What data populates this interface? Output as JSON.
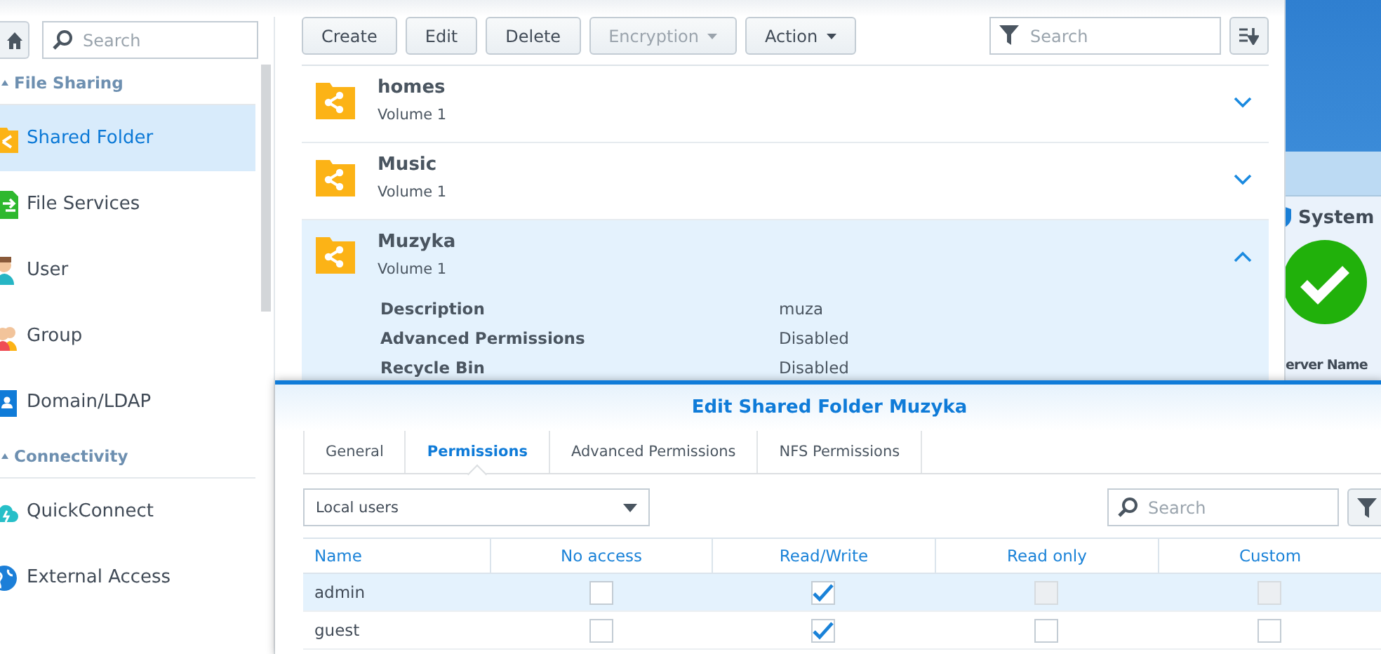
{
  "sidebar": {
    "search": {
      "placeholder": "Search"
    },
    "sections": [
      {
        "title": "File Sharing",
        "expanded": true,
        "items": [
          {
            "label": "Shared Folder",
            "kind": "shared-folder",
            "selected": true
          },
          {
            "label": "File Services",
            "kind": "file-services",
            "selected": false
          },
          {
            "label": "User",
            "kind": "user",
            "selected": false
          },
          {
            "label": "Group",
            "kind": "group",
            "selected": false
          },
          {
            "label": "Domain/LDAP",
            "kind": "domain",
            "selected": false
          }
        ]
      },
      {
        "title": "Connectivity",
        "expanded": true,
        "items": [
          {
            "label": "QuickConnect",
            "kind": "cloud",
            "selected": false
          },
          {
            "label": "External Access",
            "kind": "globe",
            "selected": false
          }
        ]
      }
    ]
  },
  "toolbar": {
    "buttons": [
      {
        "label": "Create",
        "disabled": false,
        "menu": false
      },
      {
        "label": "Edit",
        "disabled": false,
        "menu": false
      },
      {
        "label": "Delete",
        "disabled": false,
        "menu": false
      },
      {
        "label": "Encryption",
        "disabled": true,
        "menu": true
      },
      {
        "label": "Action",
        "disabled": false,
        "menu": true
      }
    ],
    "search": {
      "placeholder": "Search"
    }
  },
  "folders": [
    {
      "name": "homes",
      "volume": "Volume 1",
      "expanded": false,
      "selected": false
    },
    {
      "name": "Music",
      "volume": "Volume 1",
      "expanded": false,
      "selected": false
    },
    {
      "name": "Muzyka",
      "volume": "Volume 1",
      "expanded": true,
      "selected": true,
      "details": [
        {
          "label": "Description",
          "value": "muza"
        },
        {
          "label": "Advanced Permissions",
          "value": "Disabled"
        },
        {
          "label": "Recycle Bin",
          "value": "Disabled"
        }
      ]
    }
  ],
  "desktop_widget": {
    "title": "System",
    "server_label": "erver Name"
  },
  "dialog": {
    "title": "Edit Shared Folder Muzyka",
    "tabs": [
      {
        "label": "General",
        "selected": false
      },
      {
        "label": "Permissions",
        "selected": true
      },
      {
        "label": "Advanced Permissions",
        "selected": false
      },
      {
        "label": "NFS Permissions",
        "selected": false
      }
    ],
    "user_filter": {
      "value": "Local users"
    },
    "search": {
      "placeholder": "Search"
    },
    "columns": [
      "Name",
      "No access",
      "Read/Write",
      "Read only",
      "Custom"
    ],
    "rows": [
      {
        "name": "admin",
        "selected": true,
        "permissions": [
          {
            "checked": false,
            "disabled": false
          },
          {
            "checked": true,
            "disabled": false
          },
          {
            "checked": false,
            "disabled": true
          },
          {
            "checked": false,
            "disabled": true
          }
        ]
      },
      {
        "name": "guest",
        "selected": false,
        "permissions": [
          {
            "checked": false,
            "disabled": false
          },
          {
            "checked": true,
            "disabled": false
          },
          {
            "checked": false,
            "disabled": false
          },
          {
            "checked": false,
            "disabled": false
          }
        ]
      }
    ]
  }
}
